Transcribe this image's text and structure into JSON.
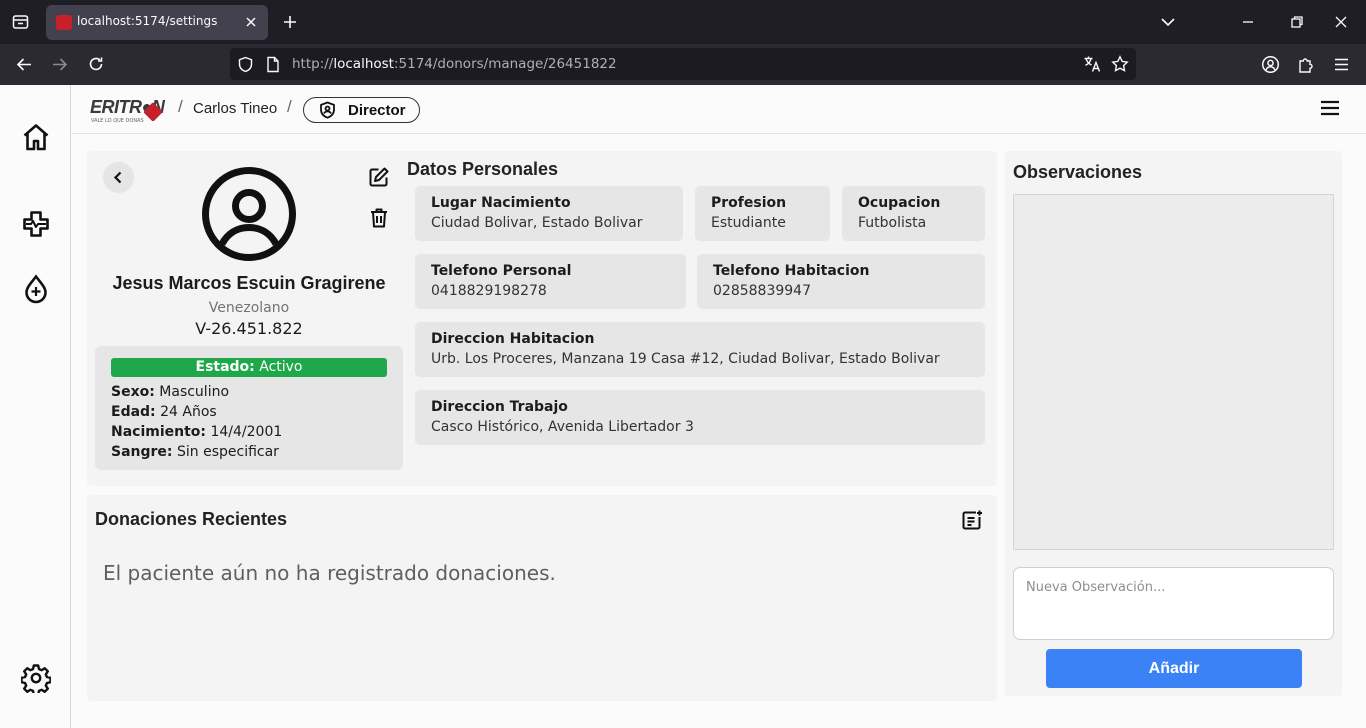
{
  "browser": {
    "tab_title": "localhost:5174/settings",
    "url_prefix": "http://",
    "url_host": "localhost",
    "url_path": ":5174/donors/manage/26451822"
  },
  "header": {
    "logo_text": "ERITR●N",
    "logo_tagline": "VALE LO QUE DONAS",
    "breadcrumb_user": "Carlos Tineo",
    "role": "Director"
  },
  "donor": {
    "name": "Jesus Marcos Escuin Gragirene",
    "nationality": "Venezolano",
    "cedula": "V-26.451.822",
    "status_label": "Estado:",
    "status_value": "Activo",
    "stats": [
      {
        "label": "Sexo:",
        "value": "Masculino"
      },
      {
        "label": "Edad:",
        "value": "24 Años"
      },
      {
        "label": "Nacimiento:",
        "value": "14/4/2001"
      },
      {
        "label": "Sangre:",
        "value": "Sin especificar"
      }
    ]
  },
  "personal": {
    "title": "Datos Personales",
    "fields": {
      "birthplace": {
        "label": "Lugar Nacimiento",
        "value": "Ciudad Bolivar, Estado Bolivar"
      },
      "profession": {
        "label": "Profesion",
        "value": "Estudiante"
      },
      "occupation": {
        "label": "Ocupacion",
        "value": "Futbolista"
      },
      "phone": {
        "label": "Telefono Personal",
        "value": "0418829198278"
      },
      "home_phone": {
        "label": "Telefono Habitacion",
        "value": "02858839947"
      },
      "home_address": {
        "label": "Direccion Habitacion",
        "value": "Urb. Los Proceres, Manzana 19 Casa #12, Ciudad Bolivar, Estado Bolivar"
      },
      "work_address": {
        "label": "Direccion Trabajo",
        "value": "Casco Histórico, Avenida Libertador 3"
      }
    }
  },
  "donations": {
    "title": "Donaciones Recientes",
    "empty_message": "El paciente aún no ha registrado donaciones."
  },
  "observations": {
    "title": "Observaciones",
    "placeholder": "Nueva Observación...",
    "button": "Añadir"
  },
  "colors": {
    "status_active": "#1ea84a",
    "primary_button": "#3a82f6",
    "brand_red": "#c6202b"
  },
  "icons": {
    "sidebar": [
      "home-icon",
      "medical-cross-icon",
      "blood-drop-add-icon",
      "settings-gear-icon"
    ],
    "actions": [
      "back-chevron-icon",
      "edit-icon",
      "trash-icon",
      "add-note-icon",
      "hamburger-menu-icon",
      "shield-user-icon"
    ]
  }
}
